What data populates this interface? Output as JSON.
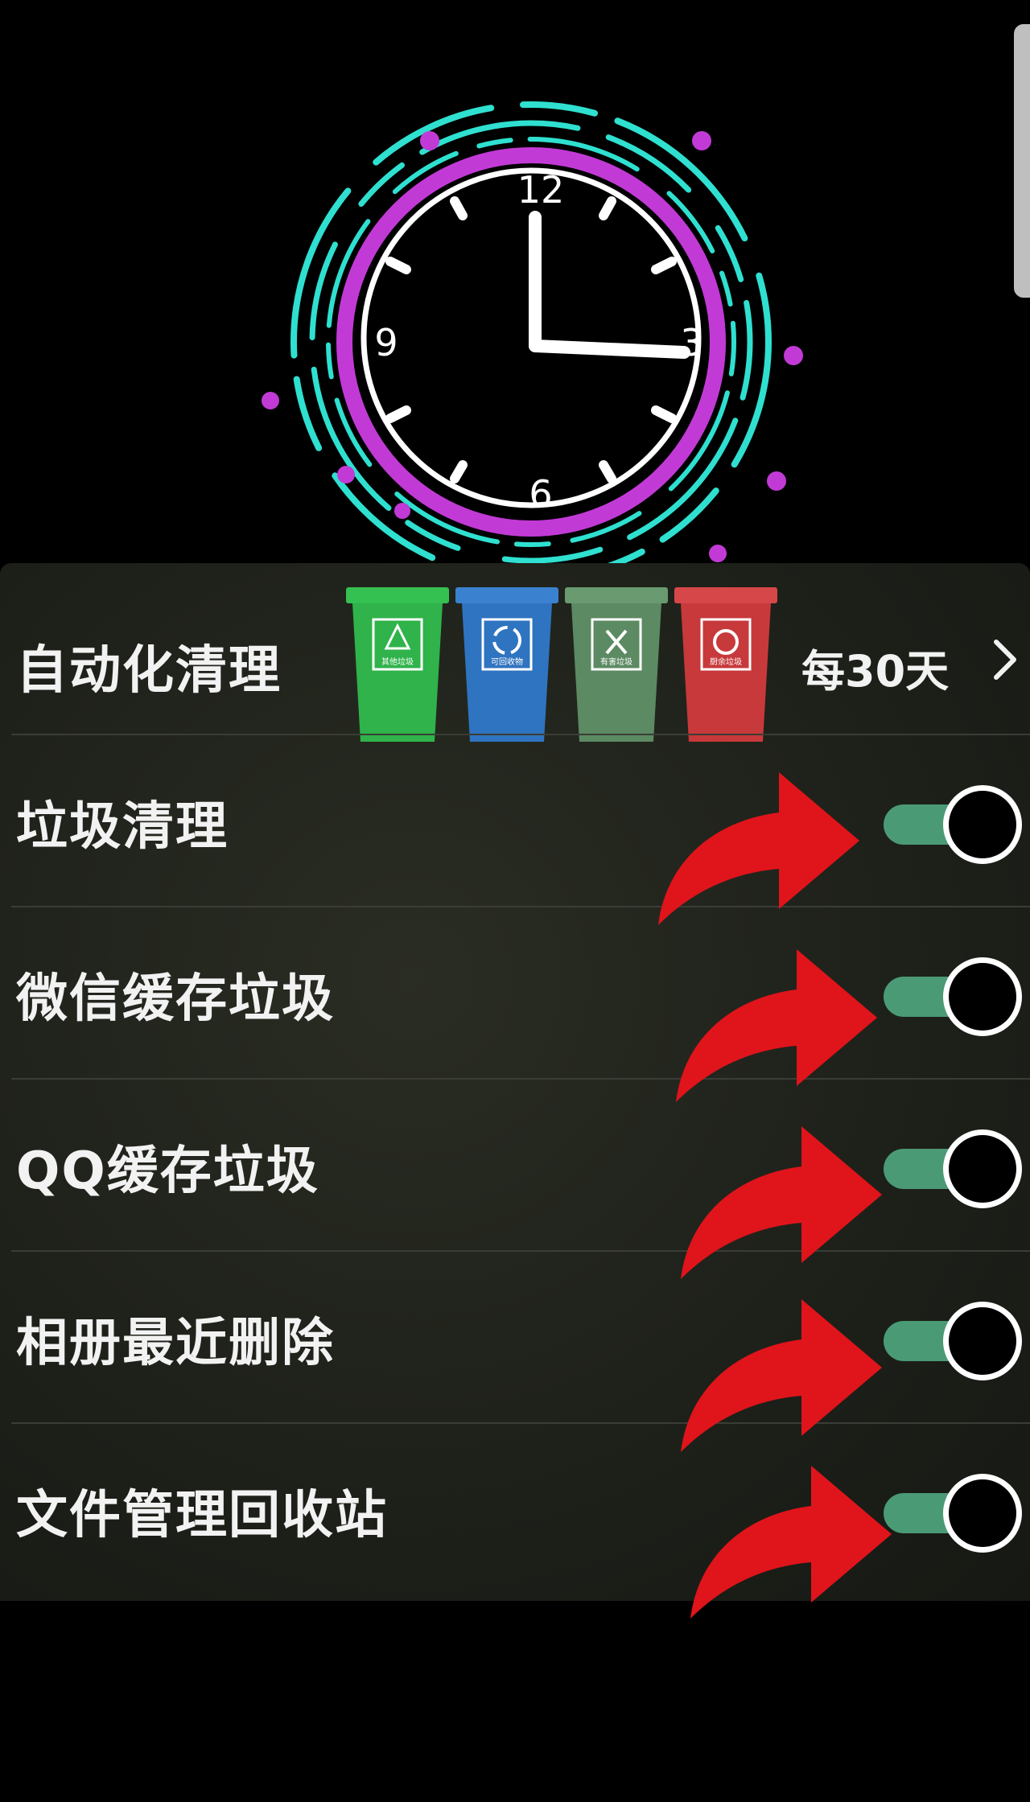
{
  "clock": {
    "numerals": [
      "12",
      "3",
      "6",
      "9"
    ],
    "ring_colors": {
      "outer": "#2fe0d0",
      "inner": "#c23ad6",
      "face": "#ffffff"
    }
  },
  "cleanup": {
    "title": "自动化清理",
    "interval": "每30天",
    "chevron_icon": "chevron-right-icon",
    "bins": [
      {
        "label": "其他垃圾",
        "color": "#2fb34a",
        "icon": "other-waste-icon"
      },
      {
        "label": "可回收物",
        "color": "#2f74c0",
        "icon": "recycle-icon"
      },
      {
        "label": "有害垃圾",
        "color": "#5c8a62",
        "icon": "hazardous-icon"
      },
      {
        "label": "厨余垃圾",
        "color": "#c8393b",
        "icon": "food-waste-icon"
      }
    ]
  },
  "settings": [
    {
      "label": "垃圾清理",
      "enabled": true
    },
    {
      "label": "微信缓存垃圾",
      "enabled": true
    },
    {
      "label": "QQ缓存垃圾",
      "enabled": true
    },
    {
      "label": "相册最近删除",
      "enabled": true
    },
    {
      "label": "文件管理回收站",
      "enabled": true
    }
  ],
  "colors": {
    "toggle_on": "#4b9a76",
    "arrow": "#e0141b",
    "panel": "#23261f"
  }
}
